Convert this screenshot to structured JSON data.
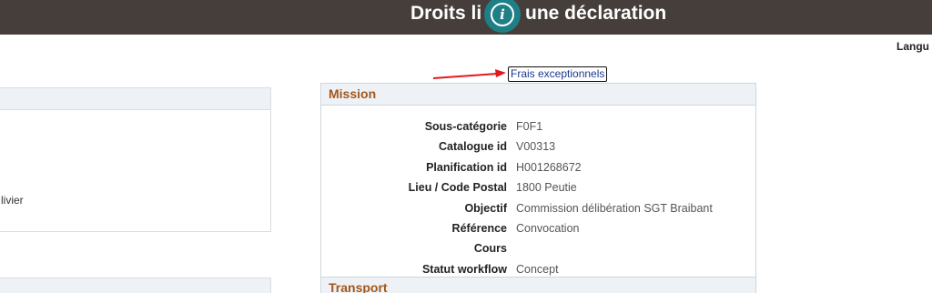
{
  "header": {
    "title_visible_left": "Droits li",
    "title_visible_right": "une déclaration"
  },
  "language_label": "Langu",
  "left_panel": {
    "partial_text": "livier"
  },
  "link": {
    "label": "Frais exceptionnels"
  },
  "mission": {
    "title": "Mission",
    "fields": [
      {
        "label": "Sous-catégorie",
        "value": "F0F1"
      },
      {
        "label": "Catalogue id",
        "value": "V00313"
      },
      {
        "label": "Planification id",
        "value": "H001268672"
      },
      {
        "label": "Lieu / Code Postal",
        "value": "1800 Peutie"
      },
      {
        "label": "Objectif",
        "value": "Commission délibération SGT Braibant"
      },
      {
        "label": "Référence",
        "value": "Convocation"
      },
      {
        "label": "Cours",
        "value": ""
      },
      {
        "label": "Statut workflow",
        "value": "Concept"
      }
    ]
  },
  "transport": {
    "title": "Transport"
  },
  "colors": {
    "header_bg": "#463e3a",
    "info_badge": "#1f7f86",
    "section_title": "#a3571a",
    "panel_header_bg": "#eef2f6",
    "annotation_arrow": "#e0191e"
  },
  "icons": {
    "info": "info-icon",
    "arrow": "red-arrow-annotation"
  }
}
